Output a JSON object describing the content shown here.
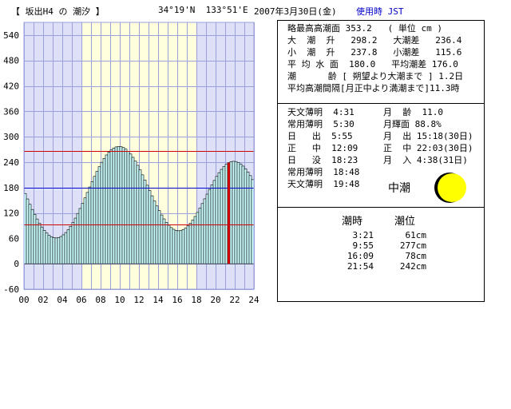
{
  "header": {
    "location": "【 坂出H4 の 潮汐 】",
    "coords": "34°19'N  133°51'E",
    "date": "2007年3月30日(金)",
    "timezone": "使用時 JST",
    "timezone_color": "#0000cc"
  },
  "info_rows": [
    {
      "l": "略最高高潮面",
      "v": "353.2",
      "r": "( 単位 cm )"
    },
    {
      "l": "大  潮  升",
      "v": "298.2",
      "r": "大潮差   236.4"
    },
    {
      "l": "小  潮  升",
      "v": "237.8",
      "r": "小潮差   115.6"
    },
    {
      "l": "平 均 水 面",
      "v": "180.0",
      "r": "平均潮差 176.0"
    },
    {
      "l": "潮      齢",
      "v": "",
      "r": "[ 朔望より大潮まで ] 1.2日"
    },
    {
      "l": "平均高潮間隔",
      "v": "",
      "r": "[月正中より満潮まで]11.3時"
    }
  ],
  "astro": {
    "left": [
      {
        "l": "天文薄明",
        "v": "4:31"
      },
      {
        "l": "常用薄明",
        "v": "5:30"
      },
      {
        "l": "日   出",
        "v": "5:55"
      },
      {
        "l": "正   中",
        "v": "12:09"
      },
      {
        "l": "日   没",
        "v": "18:23"
      },
      {
        "l": "常用薄明",
        "v": "18:48"
      },
      {
        "l": "天文薄明",
        "v": "19:48"
      }
    ],
    "right": [
      {
        "l": "月  齢",
        "v": "11.0"
      },
      {
        "l": "月輝面",
        "v": "88.8%"
      },
      {
        "l": "月  出",
        "v": "15:18(30日)"
      },
      {
        "l": "正  中",
        "v": "22:03(30日)"
      },
      {
        "l": "月  入",
        "v": "4:38(31日)"
      }
    ],
    "tide_type": "中潮",
    "moon_color": "#ffff00"
  },
  "tide_table": {
    "col1": "潮時",
    "col2": "潮位",
    "rows": [
      {
        "t": "3:21",
        "h": "61cm"
      },
      {
        "t": "9:55",
        "h": "277cm"
      },
      {
        "t": "16:09",
        "h": "78cm"
      },
      {
        "t": "21:54",
        "h": "242cm"
      }
    ]
  },
  "chart_data": {
    "type": "bar",
    "title": "",
    "xlabel": "",
    "ylabel": "",
    "xlim": [
      0,
      24
    ],
    "ylim": [
      -60,
      570
    ],
    "x_ticks": [
      "00",
      "02",
      "04",
      "06",
      "08",
      "10",
      "12",
      "14",
      "16",
      "18",
      "20",
      "22",
      "24"
    ],
    "y_ticks": [
      "540",
      "480",
      "420",
      "360",
      "300",
      "240",
      "180",
      "120",
      "60",
      "0",
      "-60"
    ],
    "bar_interval_hours": 0.25,
    "bar_color": "#ccffff",
    "current_time_hour": 21.25,
    "current_time_color": "#cc0000",
    "day_band": [
      6,
      18
    ],
    "day_color": "#ffffdd",
    "night_color": "#dde0f6",
    "reference_lines": [
      {
        "value": 266,
        "color": "#cc0000"
      },
      {
        "value": 180,
        "color": "#0000cc"
      },
      {
        "value": 93,
        "color": "#cc0000"
      }
    ],
    "extremes": [
      {
        "hour": 3.35,
        "value": 61
      },
      {
        "hour": 9.92,
        "value": 277
      },
      {
        "hour": 16.15,
        "value": 78
      },
      {
        "hour": 21.9,
        "value": 242
      }
    ]
  }
}
